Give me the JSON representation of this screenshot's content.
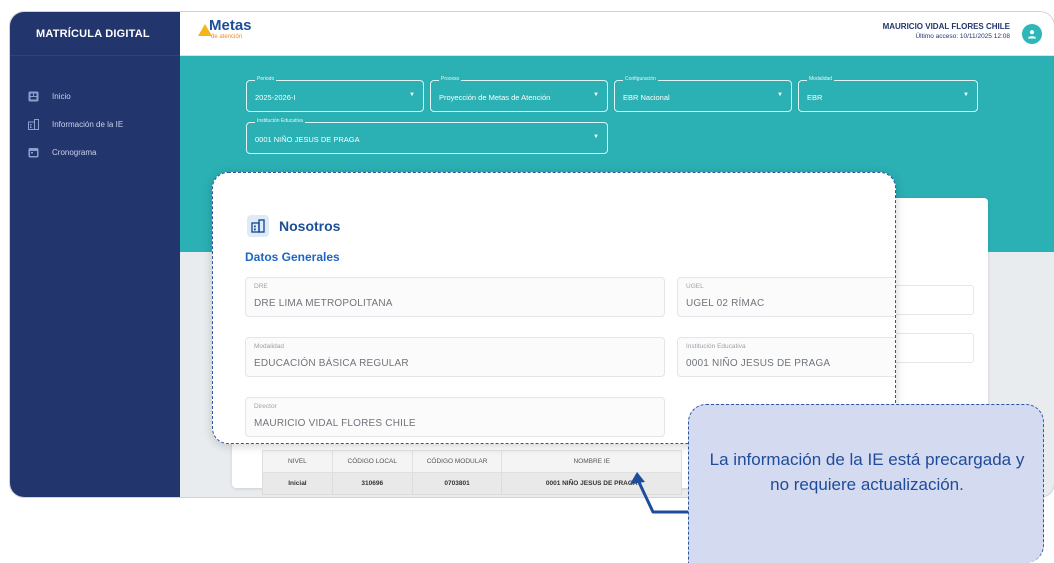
{
  "app": {
    "brand": "MATRÍCULA DIGITAL"
  },
  "logo": {
    "main": "Metas",
    "sub": "de atención"
  },
  "user": {
    "name": "MAURICIO VIDAL FLORES CHILE",
    "last_access": "Último acceso: 10/11/2025 12:08"
  },
  "sidebar": {
    "items": [
      {
        "label": "Inicio",
        "icon": "home-icon"
      },
      {
        "label": "Información de la IE",
        "icon": "building-icon"
      },
      {
        "label": "Cronograma",
        "icon": "calendar-icon"
      }
    ]
  },
  "filters": {
    "periodo": {
      "label": "Periodo",
      "value": "2025-2026-I"
    },
    "proceso": {
      "label": "Proceso",
      "value": "Proyección de Metas de Atención"
    },
    "configuracion": {
      "label": "Configuración",
      "value": "EBR Nacional"
    },
    "modalidad": {
      "label": "Modalidad",
      "value": "EBR"
    },
    "institucion": {
      "label": "Institución Educativa",
      "value": "0001 NIÑO JESUS DE PRAGA"
    }
  },
  "nosotros": {
    "title": "Nosotros",
    "section": "Datos Generales",
    "fields": {
      "dre": {
        "label": "DRE",
        "value": "DRE LIMA METROPOLITANA"
      },
      "ugel": {
        "label": "UGEL",
        "value": "UGEL 02 RÍMAC"
      },
      "modalidad": {
        "label": "Modalidad",
        "value": "EDUCACIÓN BÁSICA REGULAR"
      },
      "institucion": {
        "label": "Institución Educativa",
        "value": "0001 NIÑO JESUS DE PRAGA"
      },
      "director": {
        "label": "Director",
        "value": "MAURICIO VIDAL FLORES CHILE"
      }
    }
  },
  "table": {
    "headers": [
      "NIVEL",
      "CÓDIGO LOCAL",
      "CÓDIGO MODULAR",
      "NOMBRE IE"
    ],
    "rows": [
      [
        "Inicial",
        "310696",
        "0703801",
        "0001 NIÑO JESUS DE PRAGA"
      ]
    ]
  },
  "callout": {
    "text": "La información de la IE está precargada y no requiere actualización."
  },
  "colors": {
    "sidebar": "#23356d",
    "teal": "#2bb0b4",
    "accent": "#1f66c4",
    "callout_bg": "#d4daf0"
  }
}
